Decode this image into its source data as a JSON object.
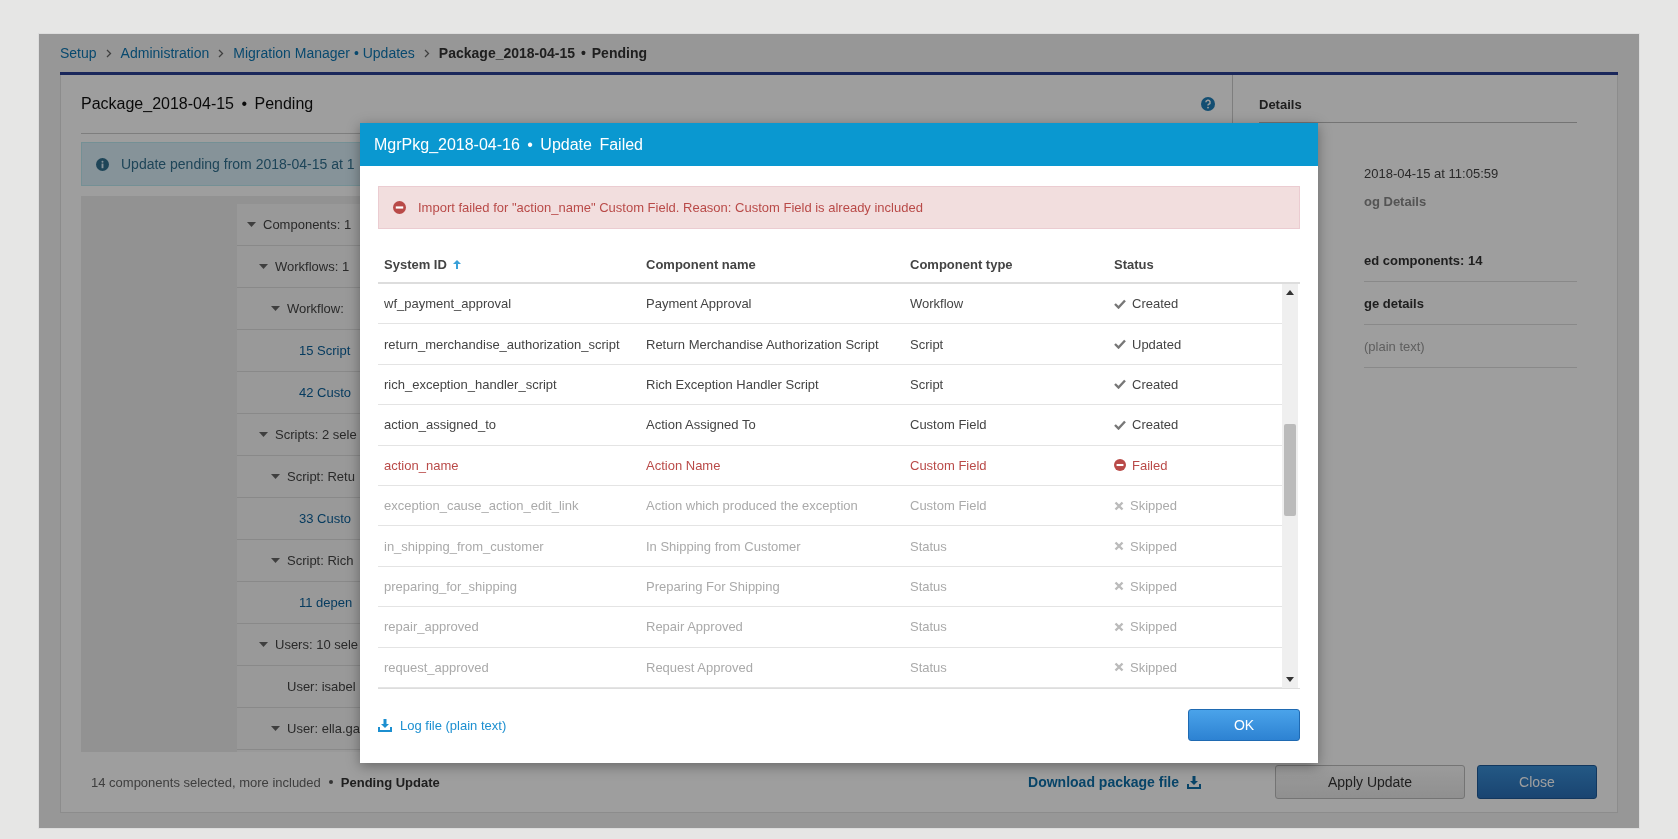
{
  "breadcrumb": [
    {
      "label": "Setup",
      "kind": "link"
    },
    {
      "label": "Administration",
      "kind": "link"
    },
    {
      "label": "Migration Manager • Updates",
      "kind": "link"
    },
    {
      "label": "Package_2018-04-15 • Pending",
      "kind": "current"
    }
  ],
  "page_title": "Package_2018-04-15 • Pending",
  "info_banner": "Update pending from 2018-04-15 at 1",
  "tree": [
    {
      "label": "Components: 1",
      "kind": "group",
      "expanded": true,
      "children": [
        {
          "label": "Workflows: 1",
          "kind": "group",
          "expanded": true,
          "children": [
            {
              "label": "Workflow:",
              "kind": "group",
              "expanded": true,
              "children": [
                {
                  "label": "15 Script",
                  "kind": "link"
                },
                {
                  "label": "42 Custo",
                  "kind": "link"
                }
              ]
            }
          ]
        },
        {
          "label": "Scripts: 2 sele",
          "kind": "group",
          "expanded": true,
          "children": [
            {
              "label": "Script: Retu",
              "kind": "group",
              "expanded": true,
              "children": [
                {
                  "label": "33 Custo",
                  "kind": "link"
                }
              ]
            },
            {
              "label": "Script: Rich",
              "kind": "group",
              "expanded": true,
              "children": [
                {
                  "label": "11 depen",
                  "kind": "link"
                }
              ]
            }
          ]
        },
        {
          "label": "Users: 10 sele",
          "kind": "group",
          "expanded": true,
          "children": [
            {
              "label": "User: isabel",
              "kind": "item"
            },
            {
              "label": "User: ella.ga",
              "kind": "group",
              "expanded": true
            }
          ]
        }
      ]
    }
  ],
  "details": {
    "title": "Details",
    "lines": [
      {
        "text": "2018-04-15 at 11:05:59",
        "kind": "plain"
      },
      {
        "text": "og Details",
        "kind": "muted-bold"
      },
      {
        "text": "ed components: 14",
        "kind": "bold"
      },
      {
        "text": "ge details",
        "kind": "bold"
      },
      {
        "text": "(plain text)",
        "kind": "muted"
      }
    ]
  },
  "footer": {
    "summary": "14 components selected, more included",
    "status": "Pending Update",
    "download": "Download package file",
    "buttons": [
      {
        "label": "Apply Update",
        "kind": "secondary"
      },
      {
        "label": "Close",
        "kind": "primary"
      }
    ]
  },
  "modal": {
    "title": "MgrPkg_2018-04-16 • Update Failed",
    "error": "Import failed for \"action_name\" Custom Field. Reason: Custom Field is already included",
    "columns": [
      {
        "label": "System ID",
        "sorted": true
      },
      {
        "label": "Component name",
        "sorted": false
      },
      {
        "label": "Component type",
        "sorted": false
      },
      {
        "label": "Status",
        "sorted": false
      }
    ],
    "rows": [
      {
        "system_id": "wf_payment_approval",
        "name": "Payment Approval",
        "type": "Workflow",
        "status": "Created",
        "kind": "created"
      },
      {
        "system_id": "return_merchandise_authorization_script",
        "name": "Return Merchandise Authorization Script",
        "type": "Script",
        "status": "Updated",
        "kind": "updated"
      },
      {
        "system_id": "rich_exception_handler_script",
        "name": "Rich Exception Handler Script",
        "type": "Script",
        "status": "Created",
        "kind": "created"
      },
      {
        "system_id": "action_assigned_to",
        "name": "Action Assigned To",
        "type": "Custom Field",
        "status": "Created",
        "kind": "created"
      },
      {
        "system_id": "action_name",
        "name": "Action Name",
        "type": "Custom Field",
        "status": "Failed",
        "kind": "failed"
      },
      {
        "system_id": "exception_cause_action_edit_link",
        "name": "Action which produced the exception",
        "type": "Custom Field",
        "status": "Skipped",
        "kind": "skipped"
      },
      {
        "system_id": "in_shipping_from_customer",
        "name": "In Shipping from Customer",
        "type": "Status",
        "status": "Skipped",
        "kind": "skipped"
      },
      {
        "system_id": "preparing_for_shipping",
        "name": "Preparing For Shipping",
        "type": "Status",
        "status": "Skipped",
        "kind": "skipped"
      },
      {
        "system_id": "repair_approved",
        "name": "Repair Approved",
        "type": "Status",
        "status": "Skipped",
        "kind": "skipped"
      },
      {
        "system_id": "request_approved",
        "name": "Request Approved",
        "type": "Status",
        "status": "Skipped",
        "kind": "skipped"
      }
    ],
    "log_link": "Log file (plain text)",
    "ok_button": "OK"
  }
}
